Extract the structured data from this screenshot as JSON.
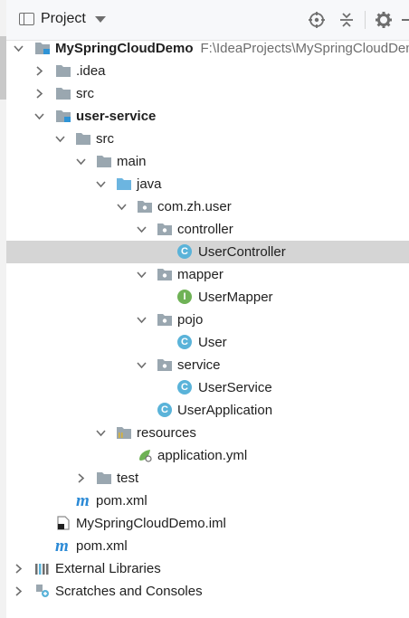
{
  "header": {
    "title": "Project",
    "icons": [
      "panel-icon",
      "target-icon",
      "collapse-all-icon",
      "gear-icon",
      "minimize-icon"
    ]
  },
  "tree": {
    "root": {
      "name": "MySpringCloudDemo",
      "path": "F:\\IdeaProjects\\MySpringCloudDemo"
    },
    "idea": ".idea",
    "src_root": "src",
    "module": "user-service",
    "src": "src",
    "main": "main",
    "java": "java",
    "package": "com.zh.user",
    "controller": "controller",
    "user_controller": "UserController",
    "mapper": "mapper",
    "user_mapper": "UserMapper",
    "pojo": "pojo",
    "user": "User",
    "service": "service",
    "user_service": "UserService",
    "user_application": "UserApplication",
    "resources": "resources",
    "application_yml": "application.yml",
    "test": "test",
    "module_pom": "pom.xml",
    "iml": "MySpringCloudDemo.iml",
    "root_pom": "pom.xml",
    "external_libraries": "External Libraries",
    "scratches": "Scratches and Consoles"
  },
  "badges": {
    "class_letter": "C",
    "interface_letter": "I",
    "maven_letter": "m"
  },
  "colors": {
    "selection": "#d5d5d5",
    "folder": "#9aa7b0",
    "source_folder": "#6cb5e0",
    "class_icon": "#5ab3d9",
    "interface_icon": "#6fb256",
    "maven": "#2b8ad6"
  }
}
